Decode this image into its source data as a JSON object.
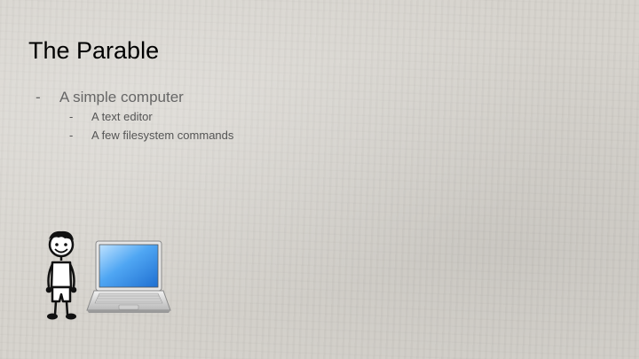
{
  "slide": {
    "title": "The Parable",
    "bullets": [
      {
        "text": "A simple computer",
        "children": [
          {
            "text": "A text editor"
          },
          {
            "text": "A few filesystem commands"
          }
        ]
      }
    ],
    "illustration": {
      "icons": [
        "stick-figure-boy-icon",
        "laptop-icon"
      ]
    }
  }
}
